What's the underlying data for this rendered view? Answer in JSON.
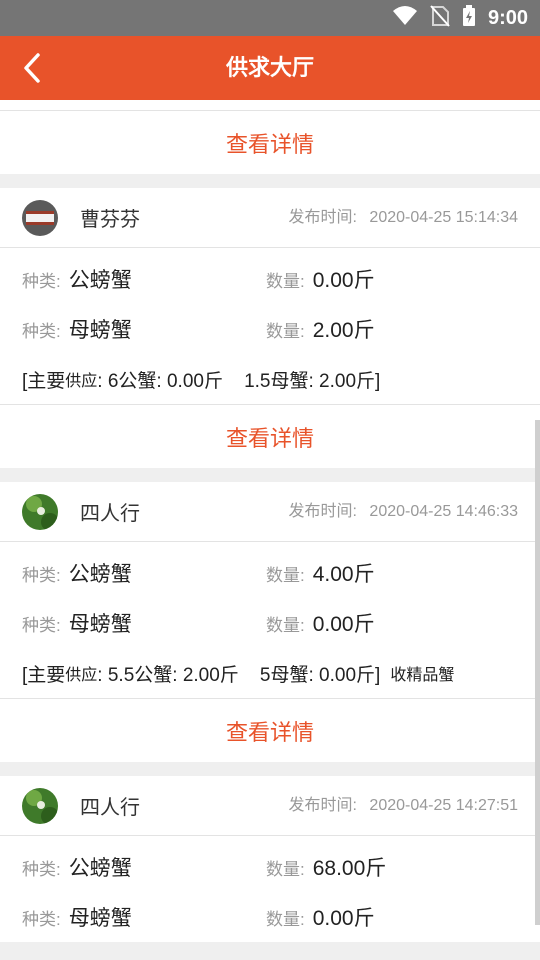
{
  "status_bar": {
    "time": "9:00"
  },
  "app_bar": {
    "title": "供求大厅"
  },
  "detail_label": "查看详情",
  "labels": {
    "publish_time": "发布时间:",
    "category": "种类:",
    "quantity": "数量:"
  },
  "cards": [
    {
      "user": "曹芬芬",
      "time": "2020-04-25 15:14:34",
      "items": [
        {
          "category": "公螃蟹",
          "quantity": "0.00斤"
        },
        {
          "category": "母螃蟹",
          "quantity": "2.00斤"
        }
      ],
      "supply_prefix": "[主要",
      "supply_small": "供应",
      "supply_rest": ": 6公蟹: 0.00斤    1.5母蟹: 2.00斤]",
      "supply_note": ""
    },
    {
      "user": "四人行",
      "time": "2020-04-25 14:46:33",
      "items": [
        {
          "category": "公螃蟹",
          "quantity": "4.00斤"
        },
        {
          "category": "母螃蟹",
          "quantity": "0.00斤"
        }
      ],
      "supply_prefix": "[主要",
      "supply_small": "供应",
      "supply_rest": ": 5.5公蟹: 2.00斤    5母蟹: 0.00斤]",
      "supply_note": "收精品蟹"
    },
    {
      "user": "四人行",
      "time": "2020-04-25 14:27:51",
      "items": [
        {
          "category": "公螃蟹",
          "quantity": "68.00斤"
        },
        {
          "category": "母螃蟹",
          "quantity": "0.00斤"
        }
      ]
    }
  ]
}
